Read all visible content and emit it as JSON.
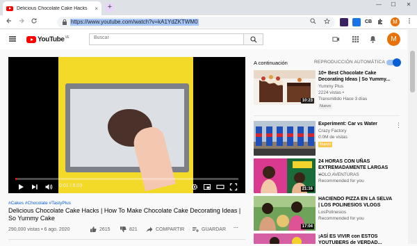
{
  "browser": {
    "tab_title": "Delicious Chocolate Cake Hacks",
    "tab_close": "×",
    "new_tab": "+",
    "url_selected": "https://www.youtube.com/watch?v=kA1YdZKTWM0",
    "win_min": "—",
    "win_max": "☐",
    "win_close": "✕",
    "profile_initial": "M",
    "ext_cb_label": "CB",
    "ext_green_label": "◉"
  },
  "youtube": {
    "logo_text": "YouTube",
    "logo_region": "VE",
    "search_placeholder": "Buscar",
    "avatar_initial": "M"
  },
  "player": {
    "time": "0:01 / 6:03",
    "progress": 0.003
  },
  "video": {
    "hashtags": "#Cakes #Chocolate #TastyPlus",
    "title": "Delicious Chocolate Cake Hacks | How To Make Chocolate Cake Decorating Ideas | So Yummy Cake",
    "meta": "290,000 vistas • 6 ago. 2020",
    "likes": "2615",
    "dislikes": "821",
    "share_label": "COMPARTIR",
    "save_label": "GUARDAR",
    "more": "···"
  },
  "sidebar": {
    "next_label": "A continuación",
    "autoplay_label": "REPRODUCCIÓN AUTOMÁTICA",
    "autoplay_on": true,
    "items": [
      {
        "title": "10+ Best Chocolate Cake Decorating Ideas | So Yummy...",
        "channel": "Yummy Plus",
        "views": "2224 vistas •",
        "extra": "Transmitido Hace 3 días",
        "duration": "10:23",
        "badge": "Nuevo"
      },
      {
        "title": "Experiment: Car vs Water",
        "channel": "Crazy Factory",
        "views": "0.0M de vistas",
        "extra": "",
        "duration": "",
        "badge": "Nuevo"
      },
      {
        "title": "24 HORAS CON UÑAS EXTREMADAMENTE LARGAS ...",
        "channel": "YOLO AVENTURAS",
        "views": "Recommended for you",
        "extra": "",
        "duration": "21:16",
        "badge": ""
      },
      {
        "title": "HACIENDO PIZZA EN LA SELVA | LOS POLINESIOS VLOGS",
        "channel": "LosPolinesios",
        "views": "Recommended for you",
        "extra": "",
        "duration": "17:04",
        "badge": ""
      },
      {
        "title": "¡ASÍ ES VIVIR con ESTOS YOUTUBERS de VERDAD...",
        "channel": "",
        "views": "",
        "extra": "",
        "duration": "",
        "badge": ""
      }
    ],
    "menu_glyph": "⋮"
  },
  "colors": {
    "accent_red": "#ff0000",
    "link_blue": "#065fd4",
    "avatar_orange": "#e8710a"
  }
}
